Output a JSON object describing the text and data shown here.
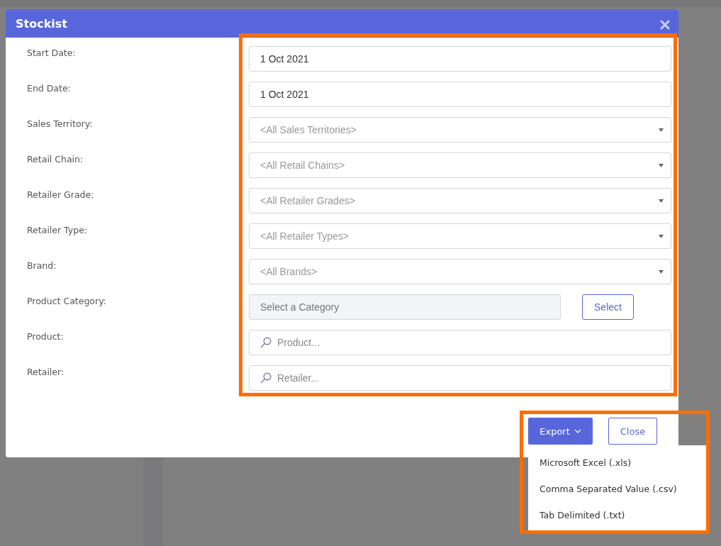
{
  "dialog": {
    "title": "Stockist"
  },
  "fields": [
    {
      "label": "Start Date:",
      "kind": "date",
      "value": "1 Oct 2021"
    },
    {
      "label": "End Date:",
      "kind": "date",
      "value": "1 Oct 2021"
    },
    {
      "label": "Sales Territory:",
      "kind": "select",
      "placeholder": "<All Sales Territories>"
    },
    {
      "label": "Retail Chain:",
      "kind": "select",
      "placeholder": "<All Retail Chains>"
    },
    {
      "label": "Retailer Grade:",
      "kind": "select",
      "placeholder": "<All Retailer Grades>"
    },
    {
      "label": "Retailer Type:",
      "kind": "select",
      "placeholder": "<All Retailer Types>"
    },
    {
      "label": "Brand:",
      "kind": "select",
      "placeholder": "<All Brands>"
    },
    {
      "label": "Product Category:",
      "kind": "category",
      "placeholder": "Select a Category",
      "button": "Select"
    },
    {
      "label": "Product:",
      "kind": "search",
      "placeholder": "Product..."
    },
    {
      "label": "Retailer:",
      "kind": "search",
      "placeholder": "Retailer..."
    }
  ],
  "footer": {
    "export_button": "Export",
    "close_button": "Close"
  },
  "export_menu": {
    "items": [
      "Microsoft Excel (.xls)",
      "Comma Separated Value (.csv)",
      "Tab Delimited (.txt)"
    ]
  }
}
